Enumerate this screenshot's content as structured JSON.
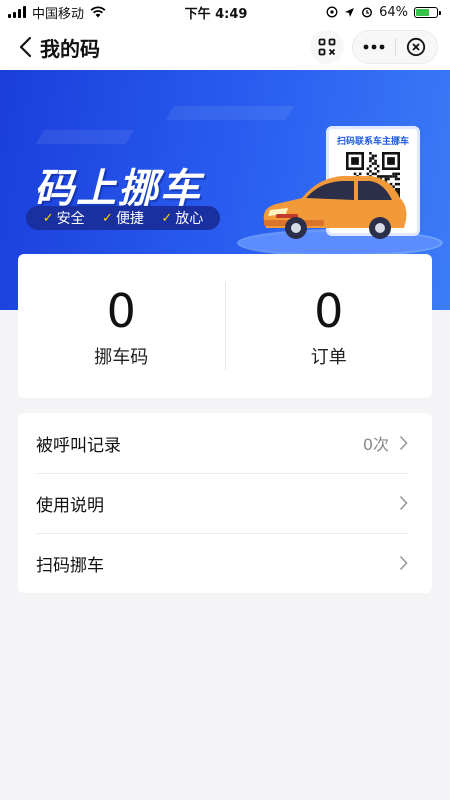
{
  "status_bar": {
    "carrier": "中国移动",
    "time": "下午 4:49",
    "battery": "64%",
    "battery_level": 0.64
  },
  "nav": {
    "title": "我的码"
  },
  "banner": {
    "headline": "码上挪车",
    "tags": [
      "安全",
      "便捷",
      "放心"
    ],
    "qr_caption": "扫码联系车主挪车"
  },
  "stats": [
    {
      "value": "0",
      "label": "挪车码"
    },
    {
      "value": "0",
      "label": "订单"
    }
  ],
  "menu": [
    {
      "label": "被呼叫记录",
      "value": "0次"
    },
    {
      "label": "使用说明",
      "value": ""
    },
    {
      "label": "扫码挪车",
      "value": ""
    }
  ],
  "colors": {
    "banner": "#2a5ff0",
    "tag_bg": "#1a2fa0",
    "car": "#f29a3a",
    "battery": "#37c24a"
  }
}
